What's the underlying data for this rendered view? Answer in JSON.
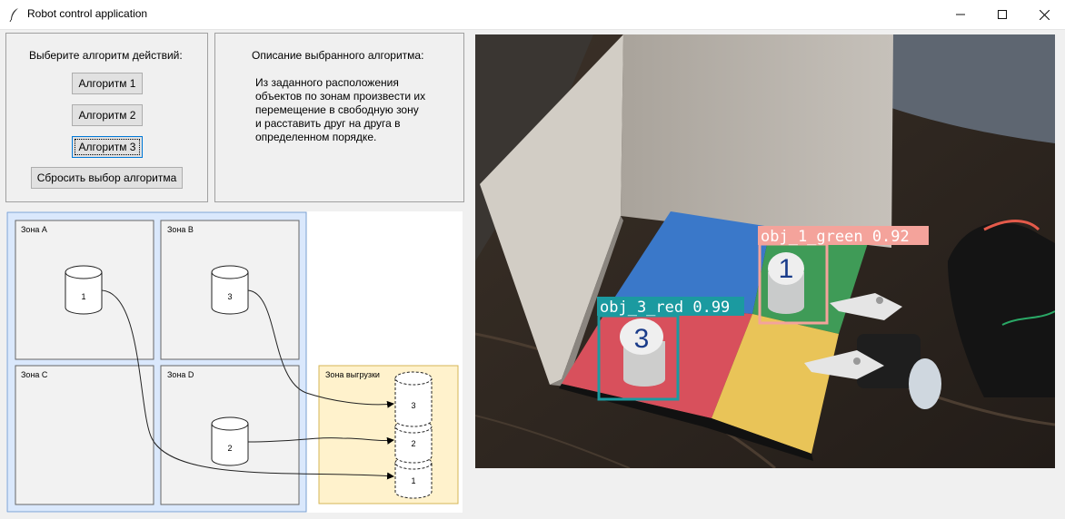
{
  "window": {
    "title": "Robot control application",
    "controls": [
      "minimize",
      "maximize",
      "close"
    ]
  },
  "algorithm_panel": {
    "prompt": "Выберите алгоритм действий:",
    "buttons": [
      "Алгоритм 1",
      "Алгоритм 2",
      "Алгоритм 3"
    ],
    "reset_label": "Сбросить выбор алгоритма",
    "focused_button": "Алгоритм 3"
  },
  "description_panel": {
    "heading": "Описание выбранного алгоритма:",
    "text_lines": [
      "Из заданного расположения",
      "объектов по зонам произвести их",
      "перемещение в свободную зону",
      "и расставить друг на друга в",
      "определенном порядке."
    ]
  },
  "diagram": {
    "zones": [
      "Зона A",
      "Зона B",
      "Зона C",
      "Зона D"
    ],
    "unload_zone": "Зона выгрузки",
    "objects": [
      {
        "zone": "Зона A",
        "label": "1"
      },
      {
        "zone": "Зона B",
        "label": "3"
      },
      {
        "zone": "Зона D",
        "label": "2"
      }
    ],
    "stack": [
      "3",
      "2",
      "1"
    ]
  },
  "camera": {
    "detections": [
      {
        "label": "obj_1_green 0.92",
        "color": "#f4a39b"
      },
      {
        "label": "obj_3_red 0.99",
        "color": "#1b9aa0"
      }
    ],
    "tiles": {
      "blue": "#3a78c9",
      "green": "#3f9b57",
      "red": "#d8505c",
      "yellow": "#e9c458"
    }
  }
}
